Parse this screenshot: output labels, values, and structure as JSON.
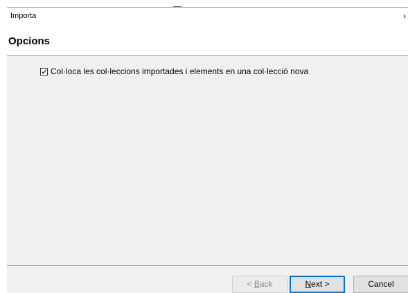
{
  "window": {
    "title": "Importa",
    "chevron": "›"
  },
  "page": {
    "heading": "Opcions"
  },
  "options": {
    "new_collection": {
      "label": "Col·loca les col·leccions importades i elements en una col·lecció nova",
      "checked": true
    }
  },
  "buttons": {
    "back": {
      "prefix": "< ",
      "accel": "B",
      "rest": "ack",
      "enabled": false
    },
    "next": {
      "accel": "N",
      "rest": "ext >",
      "enabled": true
    },
    "cancel": {
      "label": "Cancel",
      "enabled": true
    }
  },
  "colors": {
    "accent": "#0078d7",
    "panel": "#f0f0f0",
    "separator": "#a0a0a0"
  }
}
